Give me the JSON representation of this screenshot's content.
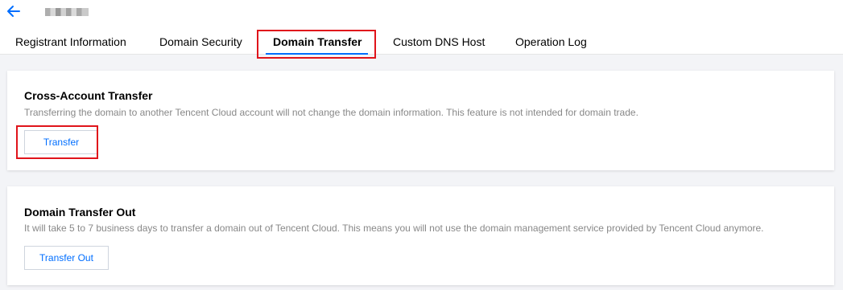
{
  "header": {
    "back_icon": "arrow-left-icon",
    "domain_name": "█▄▀▄█"
  },
  "tabs": [
    {
      "label": "Registrant Information"
    },
    {
      "label": "Domain Security"
    },
    {
      "label": "Domain Transfer",
      "active": true
    },
    {
      "label": "Custom DNS Host"
    },
    {
      "label": "Operation Log"
    }
  ],
  "cross_account": {
    "title": "Cross-Account Transfer",
    "description": "Transferring the domain to another Tencent Cloud account will not change the domain information. This feature is not intended for domain trade.",
    "button_label": "Transfer"
  },
  "transfer_out": {
    "title": "Domain Transfer Out",
    "description": "It will take 5 to 7 business days to transfer a domain out of Tencent Cloud. This means you will not use the domain management service provided by Tencent Cloud anymore.",
    "button_label": "Transfer Out"
  },
  "colors": {
    "accent": "#006eff",
    "highlight": "#e0141b",
    "muted_text": "#888888"
  }
}
